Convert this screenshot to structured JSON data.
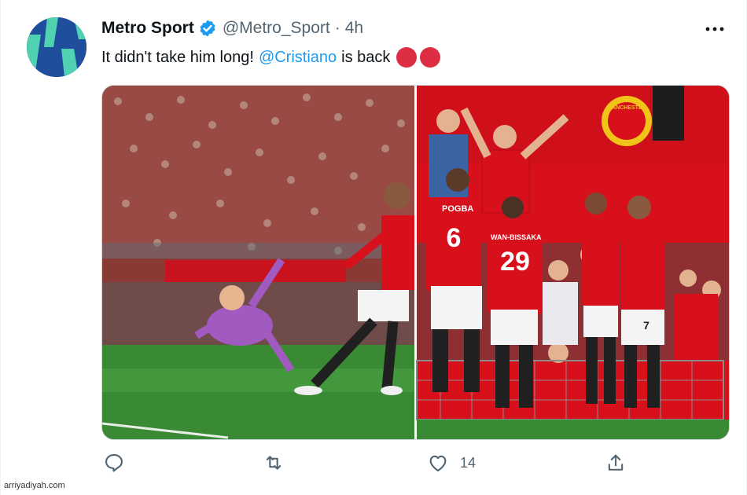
{
  "tweet": {
    "author_name": "Metro Sport",
    "author_handle": "@Metro_Sport",
    "separator": "·",
    "time": "4h",
    "text_before": "It didn't take him long!",
    "mention": "@Cristiano",
    "text_after": "is back",
    "emoji": [
      "red-circle",
      "red-circle"
    ]
  },
  "media": {
    "left_image": "goal-scoring-photo",
    "right_image": "celebration-photo",
    "jersey_numbers": [
      "6",
      "29",
      "7"
    ],
    "jersey_names": [
      "POGBA",
      "WAN-BISSAKA"
    ],
    "crest_text": "MANCHESTER"
  },
  "actions": {
    "reply_icon": "reply-icon",
    "retweet_icon": "retweet-icon",
    "like_icon": "heart-icon",
    "like_count": "14",
    "share_icon": "share-icon"
  },
  "watermark": "arriyadiyah.com",
  "colors": {
    "verified": "#1d9bf0",
    "mention": "#1d9bf0",
    "text": "#0f1419",
    "secondary": "#536471",
    "united_red": "#d8101c"
  }
}
